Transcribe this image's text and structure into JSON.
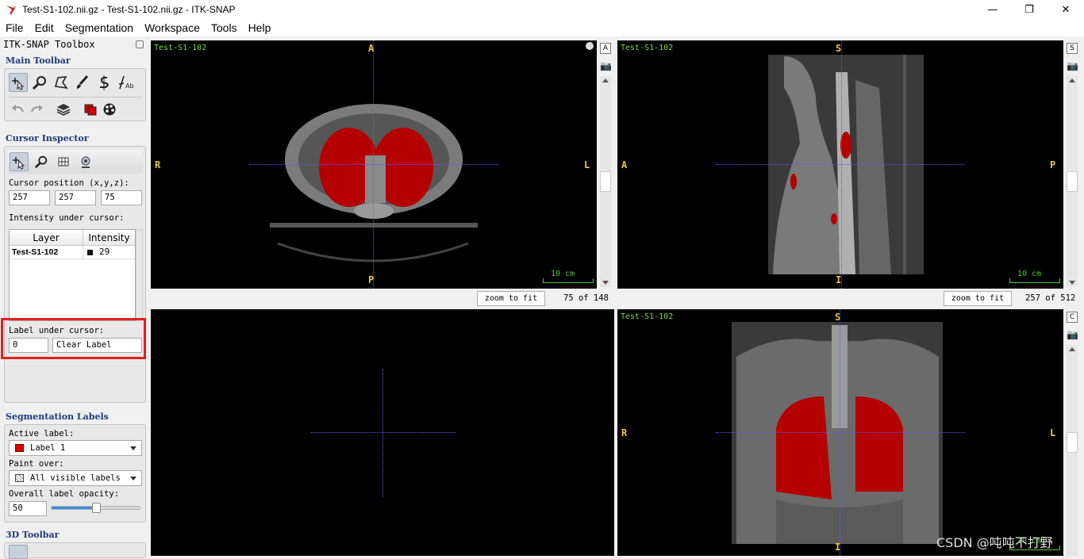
{
  "window": {
    "title": "Test-S1-102.nii.gz - Test-S1-102.nii.gz - ITK-SNAP",
    "controls": {
      "minimize": "—",
      "maximize": "❐",
      "close": "✕"
    }
  },
  "menubar": [
    "File",
    "Edit",
    "Segmentation",
    "Workspace",
    "Tools",
    "Help"
  ],
  "toolbox": {
    "title": "ITK-SNAP Toolbox",
    "main_toolbar_title": "Main Toolbar",
    "cursor_inspector": {
      "title": "Cursor Inspector",
      "position_label": "Cursor position (x,y,z):",
      "x": "257",
      "y": "257",
      "z": "75",
      "intensity_label": "Intensity under cursor:",
      "table_headers": [
        "Layer",
        "Intensity"
      ],
      "rows": [
        {
          "layer": "Test-S1-102",
          "intensity": "29"
        }
      ],
      "label_under_cursor": "Label under cursor:",
      "label_id": "0",
      "label_name": "Clear Label"
    },
    "segmentation_labels": {
      "title": "Segmentation Labels",
      "active_label_caption": "Active label:",
      "active_label": "Label 1",
      "paint_over_caption": "Paint over:",
      "paint_over": "All visible labels",
      "opacity_caption": "Overall label opacity:",
      "opacity_value": "50",
      "opacity": 0.5
    },
    "toolbar_3d_title": "3D Toolbar"
  },
  "views": {
    "axial": {
      "layer": "Test-S1-102",
      "top": "A",
      "bottom": "P",
      "left": "R",
      "right": "L",
      "scale": "10 cm",
      "zoom_button": "zoom to fit",
      "slice": "75 of 148",
      "strip_button": "A"
    },
    "sagittal": {
      "layer": "Test-S1-102",
      "top": "S",
      "bottom": "I",
      "left": "A",
      "right": "P",
      "scale": "10 cm",
      "zoom_button": "zoom to fit",
      "slice": "257 of 512",
      "strip_button": "S"
    },
    "coronal": {
      "layer": "Test-S1-102",
      "top": "S",
      "bottom": "I",
      "left": "R",
      "right": "L",
      "scale": "10 cm",
      "strip_button": "C"
    }
  },
  "watermark": "CSDN @吨吨不打野",
  "colors": {
    "accent_label": "#e00000",
    "crosshair": "#5a5aff",
    "highlight_box": "#e02020"
  }
}
